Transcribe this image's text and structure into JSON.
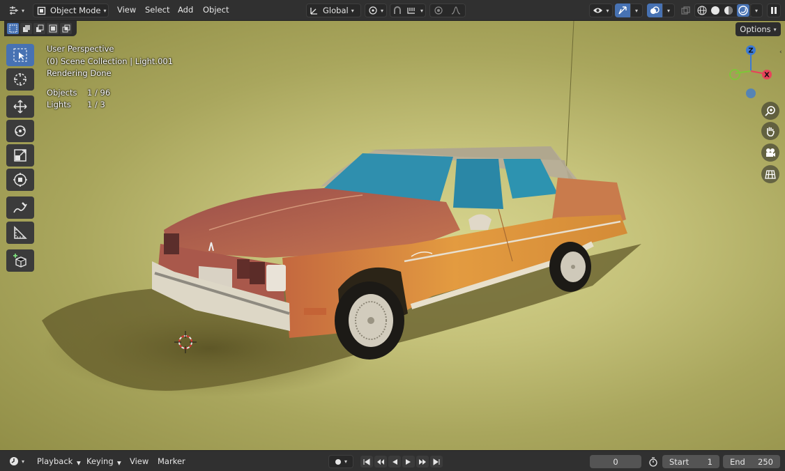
{
  "header": {
    "mode": "Object Mode",
    "menus": [
      "View",
      "Select",
      "Add",
      "Object"
    ],
    "orientation": "Global",
    "options_label": "Options"
  },
  "overlay_info": {
    "perspective": "User Perspective",
    "collection": "(0) Scene Collection | Light.001",
    "status": "Rendering Done",
    "objects_label": "Objects",
    "objects_value": "1 / 96",
    "lights_label": "Lights",
    "lights_value": "1 / 3"
  },
  "gizmo": {
    "z": "Z",
    "x": "X"
  },
  "timeline": {
    "menus": [
      "Playback",
      "Keying",
      "View",
      "Marker"
    ],
    "current_frame": "0",
    "start_label": "Start",
    "start_value": "1",
    "end_label": "End",
    "end_value": "250"
  },
  "colors": {
    "accent": "#4772b3",
    "header_bg": "#303030",
    "viewport_bg": "#c5c27a",
    "car_body": "#d89740",
    "car_hood": "#b0645a",
    "roof": "#b7ae97",
    "glass": "#2f9bb5",
    "x_axis": "#e8425a",
    "y_axis": "#7ec638",
    "z_axis": "#3b79d4"
  },
  "icons": {
    "editor_type": "editor-type-icon",
    "object_mode": "object-mode-icon",
    "transform_orientation": "transform-orientation-icon",
    "pivot": "pivot-point-icon",
    "snap": "snap-icon",
    "proportional": "proportional-editing-icon",
    "visibility": "visibility-icon",
    "gizmo_toggle": "gizmo-icon",
    "overlay": "overlay-icon",
    "xray": "xray-icon",
    "shading_wireframe": "wireframe-shading-icon",
    "shading_solid": "solid-shading-icon",
    "shading_material": "material-shading-icon",
    "shading_rendered": "rendered-shading-icon"
  }
}
